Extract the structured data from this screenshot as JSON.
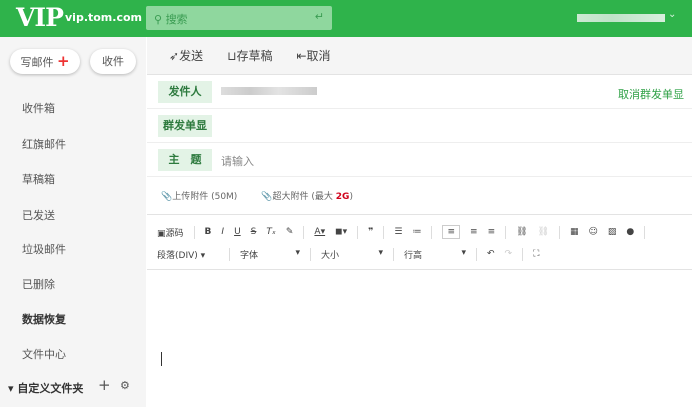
{
  "header": {
    "logo": "VIP",
    "domain": "vip.tom.com",
    "search_placeholder": "搜索"
  },
  "sidebar": {
    "compose": "写邮件",
    "receive": "收件",
    "items": [
      "收件箱",
      "红旗邮件",
      "草稿箱",
      "已发送",
      "垃圾邮件",
      "已删除",
      "数据恢复",
      "文件中心"
    ],
    "custom_folder": "自定义文件夹"
  },
  "toolbar": {
    "send": "发送",
    "save_draft": "存草稿",
    "cancel": "取消"
  },
  "form": {
    "sender_label": "发件人",
    "group_label": "群发单显",
    "cancel_group": "取消群发单显",
    "subject_label": "主　题",
    "subject_placeholder": "请输入"
  },
  "attach": {
    "upload": "上传附件 (50M)",
    "large_prefix": "超大附件 (最大 ",
    "large_size": "2G",
    "large_suffix": ")"
  },
  "editor": {
    "source": "源码",
    "paragraph": "段落(DIV)",
    "font": "字体",
    "size": "大小",
    "line_height": "行高"
  }
}
